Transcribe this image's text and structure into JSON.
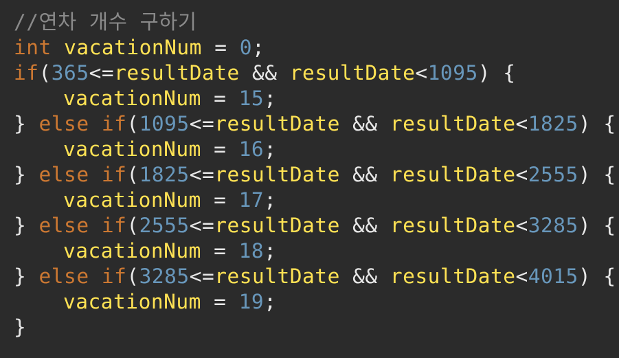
{
  "code": {
    "comment": "//연차 개수 구하기",
    "kw_int": "int",
    "kw_if": "if",
    "kw_else": "else",
    "var": "vacationNum",
    "cond_var": "resultDate",
    "init_value": "0",
    "first_condition": {
      "lower": "365",
      "upper": "1095",
      "value": "15"
    },
    "else_conditions": [
      {
        "lower": "1095",
        "upper": "1825",
        "value": "16"
      },
      {
        "lower": "1825",
        "upper": "2555",
        "value": "17"
      },
      {
        "lower": "2555",
        "upper": "3285",
        "value": "18"
      },
      {
        "lower": "3285",
        "upper": "4015",
        "value": "19"
      }
    ],
    "op_assign": "=",
    "op_lte": "<=",
    "op_lt": "<",
    "op_and": "&&",
    "semicolon": ";",
    "paren_open": "(",
    "paren_close": ")",
    "brace_open": "{",
    "brace_close": "}"
  }
}
